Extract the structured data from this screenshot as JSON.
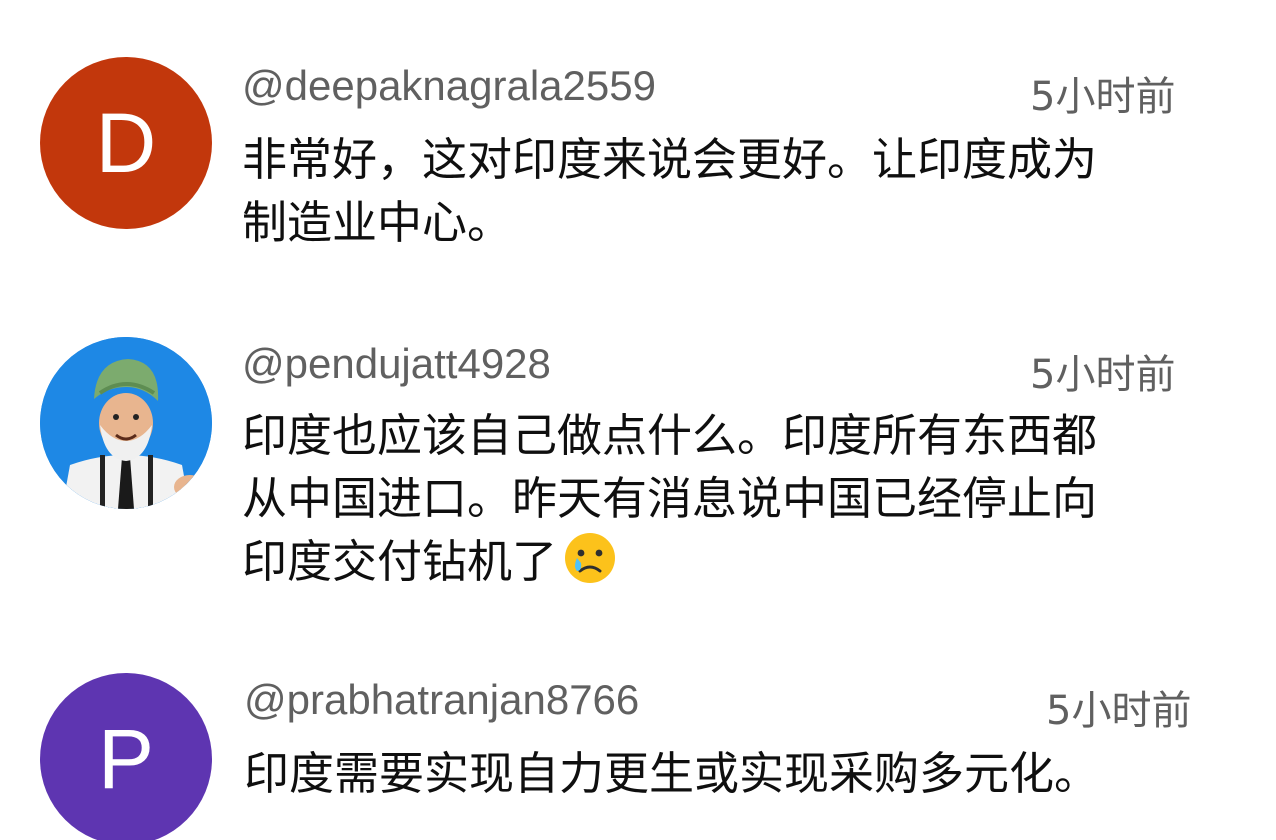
{
  "comments": [
    {
      "avatar_letter": "D",
      "avatar_color": "#c2370c",
      "handle": "@deepaknagrala2559",
      "time": "5小时前",
      "lines": [
        "非常好，这对印度来说会更好。让印度成为",
        "制造业中心。"
      ]
    },
    {
      "avatar_image": "cartoon-turbaned-man-avatar",
      "avatar_color": "#1e88e5",
      "handle": "@pendujatt4928",
      "time": "5小时前",
      "lines": [
        "印度也应该自己做点什么。印度所有东西都",
        "从中国进口。昨天有消息说中国已经停止向",
        "印度交付钻机了"
      ],
      "emoji": "crying-face-icon"
    },
    {
      "avatar_letter": "P",
      "avatar_color": "#5e35b1",
      "handle": "@prabhatranjan8766",
      "time": "5小时前",
      "lines": [
        "印度需要实现自力更生或实现采购多元化。"
      ]
    }
  ]
}
